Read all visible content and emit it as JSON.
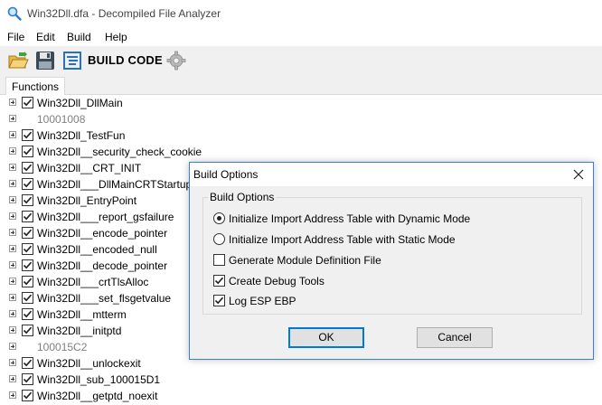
{
  "window": {
    "title": "Win32Dll.dfa - Decompiled File Analyzer"
  },
  "menu": {
    "items": [
      "File",
      "Edit",
      "Build",
      "Help"
    ]
  },
  "toolbar": {
    "build_code_label": "BUILD CODE"
  },
  "tabs": {
    "functions_label": "Functions"
  },
  "tree": {
    "rows": [
      {
        "label": "Win32Dll_DllMain",
        "checkbox": true
      },
      {
        "label": "10001008",
        "checkbox": false
      },
      {
        "label": "Win32Dll_TestFun",
        "checkbox": true
      },
      {
        "label": "Win32Dll__security_check_cookie",
        "checkbox": true
      },
      {
        "label": "Win32Dll__CRT_INIT",
        "checkbox": true
      },
      {
        "label": "Win32Dll___DllMainCRTStartup",
        "checkbox": true
      },
      {
        "label": "Win32Dll_EntryPoint",
        "checkbox": true
      },
      {
        "label": "Win32Dll___report_gsfailure",
        "checkbox": true
      },
      {
        "label": "Win32Dll__encode_pointer",
        "checkbox": true
      },
      {
        "label": "Win32Dll__encoded_null",
        "checkbox": true
      },
      {
        "label": "Win32Dll__decode_pointer",
        "checkbox": true
      },
      {
        "label": "Win32Dll___crtTlsAlloc",
        "checkbox": true
      },
      {
        "label": "Win32Dll___set_flsgetvalue",
        "checkbox": true
      },
      {
        "label": "Win32Dll__mtterm",
        "checkbox": true
      },
      {
        "label": "Win32Dll__initptd",
        "checkbox": true
      },
      {
        "label": "100015C2",
        "checkbox": false
      },
      {
        "label": "Win32Dll__unlockexit",
        "checkbox": true
      },
      {
        "label": "Win32Dll_sub_100015D1",
        "checkbox": true
      },
      {
        "label": "Win32Dll__getptd_noexit",
        "checkbox": true
      }
    ]
  },
  "dialog": {
    "title": "Build Options",
    "group_label": "Build Options",
    "options": {
      "dynamic": {
        "label": "Initialize Import Address Table with Dynamic Mode",
        "selected": true
      },
      "static": {
        "label": "Initialize Import Address Table with Static Mode",
        "selected": false
      },
      "module_def": {
        "label": "Generate Module Definition File",
        "checked": false
      },
      "debug_tools": {
        "label": "Create Debug Tools",
        "checked": true
      },
      "log_esp": {
        "label": "Log ESP EBP",
        "checked": true
      }
    },
    "ok_label": "OK",
    "cancel_label": "Cancel"
  },
  "colors": {
    "accent": "#0078d7",
    "dialog_border": "#3a7fd5"
  }
}
